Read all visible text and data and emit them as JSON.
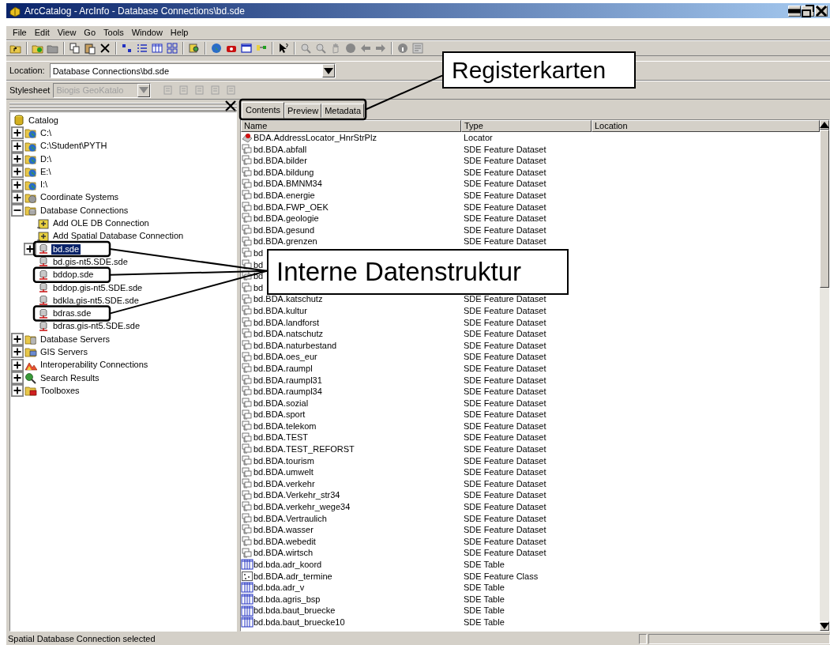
{
  "window": {
    "title": "ArcCatalog - ArcInfo - Database Connections\\bd.sde"
  },
  "menu": [
    "File",
    "Edit",
    "View",
    "Go",
    "Tools",
    "Window",
    "Help"
  ],
  "location": {
    "label": "Location:",
    "value": "Database Connections\\bd.sde"
  },
  "stylesheet": {
    "label": "Stylesheet",
    "value": "Biogis GeoKatalo",
    "disabled": true
  },
  "tree": [
    {
      "label": "Catalog",
      "kind": "catalog",
      "selected": false,
      "children": [
        {
          "label": "C:\\",
          "kind": "drive",
          "selected": false,
          "expanded": false
        },
        {
          "label": "C:\\Student\\PYTH",
          "kind": "drive",
          "selected": false,
          "expanded": false
        },
        {
          "label": "D:\\",
          "kind": "drive",
          "selected": false,
          "expanded": false
        },
        {
          "label": "E:\\",
          "kind": "drive",
          "selected": false,
          "expanded": false
        },
        {
          "label": "I:\\",
          "kind": "drive",
          "selected": false,
          "expanded": false
        },
        {
          "label": "Coordinate Systems",
          "kind": "coord",
          "selected": false,
          "expanded": false
        },
        {
          "label": "Database Connections",
          "kind": "dbconn",
          "selected": false,
          "expanded": true,
          "children": [
            {
              "label": "Add OLE DB Connection",
              "kind": "add",
              "selected": false,
              "framed": false
            },
            {
              "label": "Add Spatial Database Connection",
              "kind": "add",
              "selected": false,
              "framed": false
            },
            {
              "label": "bd.sde",
              "kind": "sde",
              "selected": true,
              "expanded": false,
              "framed": true
            },
            {
              "label": "bd.gis-nt5.SDE.sde",
              "kind": "sde",
              "selected": false,
              "framed": false
            },
            {
              "label": "bddop.sde",
              "kind": "sde",
              "selected": false,
              "framed": true
            },
            {
              "label": "bddop.gis-nt5.SDE.sde",
              "kind": "sde",
              "selected": false,
              "framed": false
            },
            {
              "label": "bdkla.gis-nt5.SDE.sde",
              "kind": "sde",
              "selected": false,
              "framed": false
            },
            {
              "label": "bdras.sde",
              "kind": "sde",
              "selected": false,
              "framed": true
            },
            {
              "label": "bdras.gis-nt5.SDE.sde",
              "kind": "sde",
              "selected": false,
              "framed": false
            }
          ]
        },
        {
          "label": "Database Servers",
          "kind": "dbserver",
          "selected": false,
          "expanded": false
        },
        {
          "label": "GIS Servers",
          "kind": "gisserver",
          "selected": false,
          "expanded": false
        },
        {
          "label": "Interoperability Connections",
          "kind": "interop",
          "selected": false,
          "expanded": false
        },
        {
          "label": "Search Results",
          "kind": "search",
          "selected": false,
          "expanded": false
        },
        {
          "label": "Toolboxes",
          "kind": "toolbox",
          "selected": false,
          "expanded": false
        }
      ]
    }
  ],
  "tabs": [
    {
      "label": "Contents",
      "selected": true
    },
    {
      "label": "Preview",
      "selected": false
    },
    {
      "label": "Metadata",
      "selected": false
    }
  ],
  "columns": [
    "Name",
    "Type",
    "Location"
  ],
  "rows": [
    {
      "name": "BDA.AddressLocator_HnrStrPlz",
      "type": "Locator",
      "kind": "locator"
    },
    {
      "name": "bd.BDA.abfall",
      "type": "SDE Feature Dataset",
      "kind": "dataset"
    },
    {
      "name": "bd.BDA.bilder",
      "type": "SDE Feature Dataset",
      "kind": "dataset"
    },
    {
      "name": "bd.BDA.bildung",
      "type": "SDE Feature Dataset",
      "kind": "dataset"
    },
    {
      "name": "bd.BDA.BMNM34",
      "type": "SDE Feature Dataset",
      "kind": "dataset"
    },
    {
      "name": "bd.BDA.energie",
      "type": "SDE Feature Dataset",
      "kind": "dataset"
    },
    {
      "name": "bd.BDA.FWP_OEK",
      "type": "SDE Feature Dataset",
      "kind": "dataset"
    },
    {
      "name": "bd.BDA.geologie",
      "type": "SDE Feature Dataset",
      "kind": "dataset"
    },
    {
      "name": "bd.BDA.gesund",
      "type": "SDE Feature Dataset",
      "kind": "dataset"
    },
    {
      "name": "bd.BDA.grenzen",
      "type": "SDE Feature Dataset",
      "kind": "dataset"
    },
    {
      "name": "bd",
      "kind": "dataset"
    },
    {
      "name": "bd",
      "kind": "dataset"
    },
    {
      "name": "bd",
      "kind": "dataset"
    },
    {
      "name": "bd",
      "kind": "dataset"
    },
    {
      "name": "bd.BDA.katschutz",
      "type": "SDE Feature Dataset",
      "kind": "dataset"
    },
    {
      "name": "bd.BDA.kultur",
      "type": "SDE Feature Dataset",
      "kind": "dataset"
    },
    {
      "name": "bd.BDA.landforst",
      "type": "SDE Feature Dataset",
      "kind": "dataset"
    },
    {
      "name": "bd.BDA.natschutz",
      "type": "SDE Feature Dataset",
      "kind": "dataset"
    },
    {
      "name": "bd.BDA.naturbestand",
      "type": "SDE Feature Dataset",
      "kind": "dataset"
    },
    {
      "name": "bd.BDA.oes_eur",
      "type": "SDE Feature Dataset",
      "kind": "dataset"
    },
    {
      "name": "bd.BDA.raumpl",
      "type": "SDE Feature Dataset",
      "kind": "dataset"
    },
    {
      "name": "bd.BDA.raumpl31",
      "type": "SDE Feature Dataset",
      "kind": "dataset"
    },
    {
      "name": "bd.BDA.raumpl34",
      "type": "SDE Feature Dataset",
      "kind": "dataset"
    },
    {
      "name": "bd.BDA.sozial",
      "type": "SDE Feature Dataset",
      "kind": "dataset"
    },
    {
      "name": "bd.BDA.sport",
      "type": "SDE Feature Dataset",
      "kind": "dataset"
    },
    {
      "name": "bd.BDA.telekom",
      "type": "SDE Feature Dataset",
      "kind": "dataset"
    },
    {
      "name": "bd.BDA.TEST",
      "type": "SDE Feature Dataset",
      "kind": "dataset"
    },
    {
      "name": "bd.BDA.TEST_REFORST",
      "type": "SDE Feature Dataset",
      "kind": "dataset"
    },
    {
      "name": "bd.BDA.tourism",
      "type": "SDE Feature Dataset",
      "kind": "dataset"
    },
    {
      "name": "bd.BDA.umwelt",
      "type": "SDE Feature Dataset",
      "kind": "dataset"
    },
    {
      "name": "bd.BDA.verkehr",
      "type": "SDE Feature Dataset",
      "kind": "dataset"
    },
    {
      "name": "bd.BDA.Verkehr_str34",
      "type": "SDE Feature Dataset",
      "kind": "dataset"
    },
    {
      "name": "bd.BDA.verkehr_wege34",
      "type": "SDE Feature Dataset",
      "kind": "dataset"
    },
    {
      "name": "bd.BDA.Vertraulich",
      "type": "SDE Feature Dataset",
      "kind": "dataset"
    },
    {
      "name": "bd.BDA.wasser",
      "type": "SDE Feature Dataset",
      "kind": "dataset"
    },
    {
      "name": "bd.BDA.webedit",
      "type": "SDE Feature Dataset",
      "kind": "dataset"
    },
    {
      "name": "bd.BDA.wirtsch",
      "type": "SDE Feature Dataset",
      "kind": "dataset"
    },
    {
      "name": "bd.bda.adr_koord",
      "type": "SDE Table",
      "kind": "table"
    },
    {
      "name": "bd.BDA.adr_termine",
      "type": "SDE Feature Class",
      "kind": "featureclass"
    },
    {
      "name": "bd.bda.adr_v",
      "type": "SDE Table",
      "kind": "table"
    },
    {
      "name": "bd.bda.agris_bsp",
      "type": "SDE Table",
      "kind": "table"
    },
    {
      "name": "bd.bda.baut_bruecke",
      "type": "SDE Table",
      "kind": "table"
    },
    {
      "name": "bd.bda.baut_bruecke10",
      "type": "SDE Table",
      "kind": "table"
    }
  ],
  "status_bar": "Spatial Database Connection selected",
  "annotations": [
    {
      "text": "Registerkarten",
      "kind": "tabs"
    },
    {
      "text": "Interne Datenstruktur",
      "kind": "tree"
    }
  ]
}
